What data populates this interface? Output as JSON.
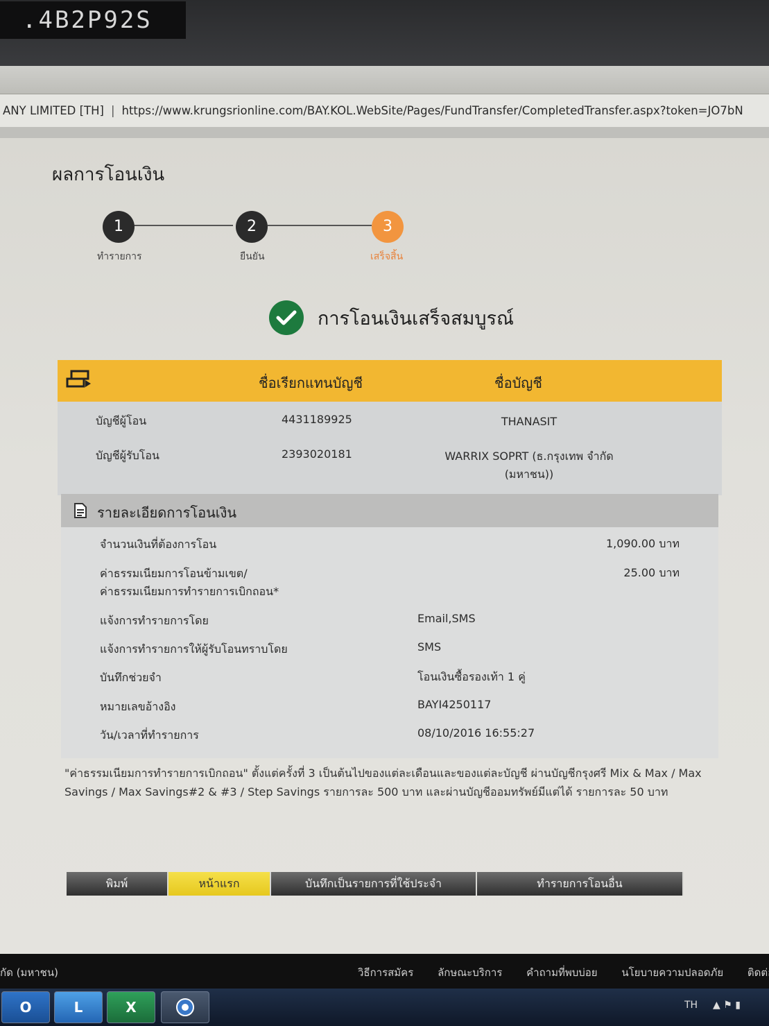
{
  "photo": {
    "sticker_text": ".4B2P92S"
  },
  "browser": {
    "cert_name": "ANY LIMITED [TH]",
    "url": "https://www.krungsrionline.com/BAY.KOL.WebSite/Pages/FundTransfer/CompletedTransfer.aspx?token=JO7bN"
  },
  "page": {
    "title": "ผลการโอนเงิน",
    "steps": [
      {
        "number": "1",
        "label": "ทำรายการ",
        "state": "done"
      },
      {
        "number": "2",
        "label": "ยืนยัน",
        "state": "done"
      },
      {
        "number": "3",
        "label": "เสร็จสิ้น",
        "state": "active"
      }
    ],
    "success_message": "การโอนเงินเสร็จสมบูรณ์",
    "accounts": {
      "header_nickname": "ชื่อเรียกแทนบัญชี",
      "header_account_name": "ชื่อบัญชี",
      "rows": [
        {
          "label": "บัญชีผู้โอน",
          "number": "4431189925",
          "name_line1": "THANASIT",
          "name_line2": ""
        },
        {
          "label": "บัญชีผู้รับโอน",
          "number": "2393020181",
          "name_line1": "WARRIX SOPRT (ธ.กรุงเทพ จำกัด",
          "name_line2": "(มหาชน))"
        }
      ]
    },
    "details": {
      "title": "รายละเอียดการโอนเงิน",
      "amount_label": "จำนวนเงินที่ต้องการโอน",
      "amount_value": "1,090.00 บาท",
      "fee_label_line1": "ค่าธรรมเนียมการโอนข้ามเขต/",
      "fee_label_line2": "ค่าธรรมเนียมการทำรายการเบิกถอน*",
      "fee_value": "25.00 บาท",
      "notify_label": "แจ้งการทำรายการโดย",
      "notify_value": "Email,SMS",
      "notify_recipient_label": "แจ้งการทำรายการให้ผู้รับโอนทราบโดย",
      "notify_recipient_value": "SMS",
      "memo_label": "บันทึกช่วยจำ",
      "memo_value": "โอนเงินซื้อรองเท้า 1 คู่",
      "ref_label": "หมายเลขอ้างอิง",
      "ref_value": "BAYI4250117",
      "datetime_label": "วัน/เวลาที่ทำรายการ",
      "datetime_value": "08/10/2016 16:55:27"
    },
    "footnote": "\"ค่าธรรมเนียมการทำรายการเบิกถอน\" ตั้งแต่ครั้งที่ 3 เป็นต้นไปของแต่ละเดือนและของแต่ละบัญชี ผ่านบัญชีกรุงศรี Mix & Max / Max Savings / Max Savings#2 & #3 / Step Savings รายการละ 500 บาท และผ่านบัญชีออมทรัพย์มีแต่ได้ รายการละ 50 บาท",
    "actions": {
      "print": "พิมพ์",
      "home": "หน้าแรก",
      "save_favorite": "บันทึกเป็นรายการที่ใช้ประจำ",
      "new_transfer": "ทำรายการโอนอื่น"
    }
  },
  "footer": {
    "company": "กัด (มหาชน)",
    "links": [
      "วิธีการสมัคร",
      "ลักษณะบริการ",
      "คำถามที่พบบ่อย",
      "นโยบายความปลอดภัย",
      "ติดต่อธน"
    ]
  },
  "taskbar": {
    "language": "TH"
  }
}
